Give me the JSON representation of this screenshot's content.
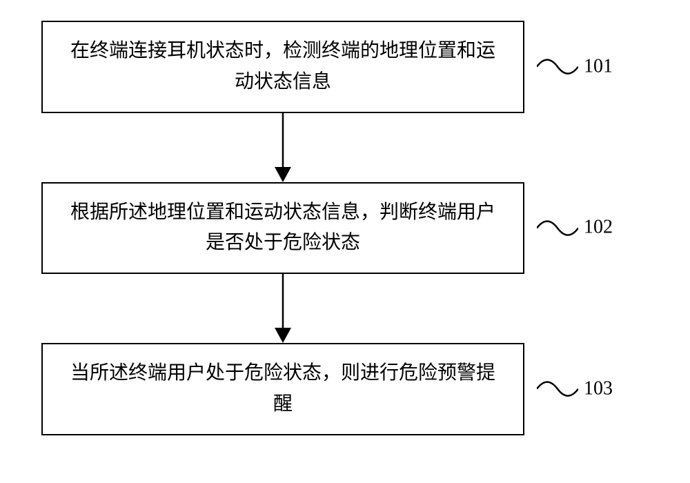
{
  "flowchart": {
    "steps": [
      {
        "text": "在终端连接耳机状态时，检测终端的地理位置和运动状态信息",
        "label": "101"
      },
      {
        "text": "根据所述地理位置和运动状态信息，判断终端用户是否处于危险状态",
        "label": "102"
      },
      {
        "text": "当所述终端用户处于危险状态，则进行危险预警提醒",
        "label": "103"
      }
    ]
  }
}
